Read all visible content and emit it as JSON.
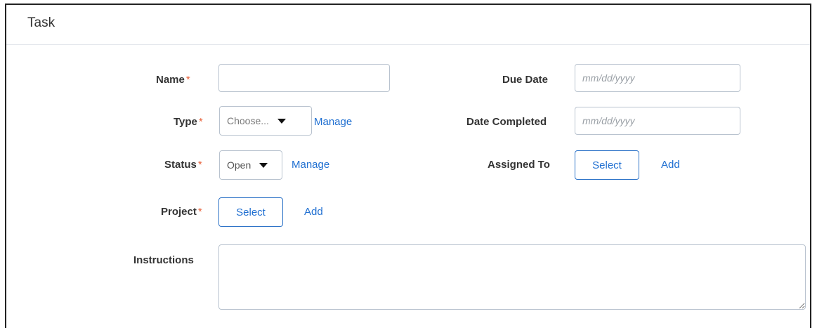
{
  "panel": {
    "title": "Task"
  },
  "required_mark": "*",
  "fields": {
    "name": {
      "label": "Name",
      "value": "",
      "placeholder": ""
    },
    "type": {
      "label": "Type",
      "selected": "Choose...",
      "manage_label": "Manage"
    },
    "status": {
      "label": "Status",
      "selected": "Open",
      "manage_label": "Manage"
    },
    "project": {
      "label": "Project",
      "select_label": "Select",
      "add_label": "Add"
    },
    "instructions": {
      "label": "Instructions",
      "value": ""
    },
    "due_date": {
      "label": "Due Date",
      "placeholder": "mm/dd/yyyy"
    },
    "date_completed": {
      "label": "Date Completed",
      "placeholder": "mm/dd/yyyy"
    },
    "assigned_to": {
      "label": "Assigned To",
      "select_label": "Select",
      "add_label": "Add"
    }
  },
  "icons": {
    "dropdown": "caret-down-icon",
    "resize": "resize-handle-icon"
  },
  "colors": {
    "link": "#1f6fd1",
    "required": "#e8623b",
    "border": "#b9c3cf",
    "button_border": "#2f74c8"
  }
}
